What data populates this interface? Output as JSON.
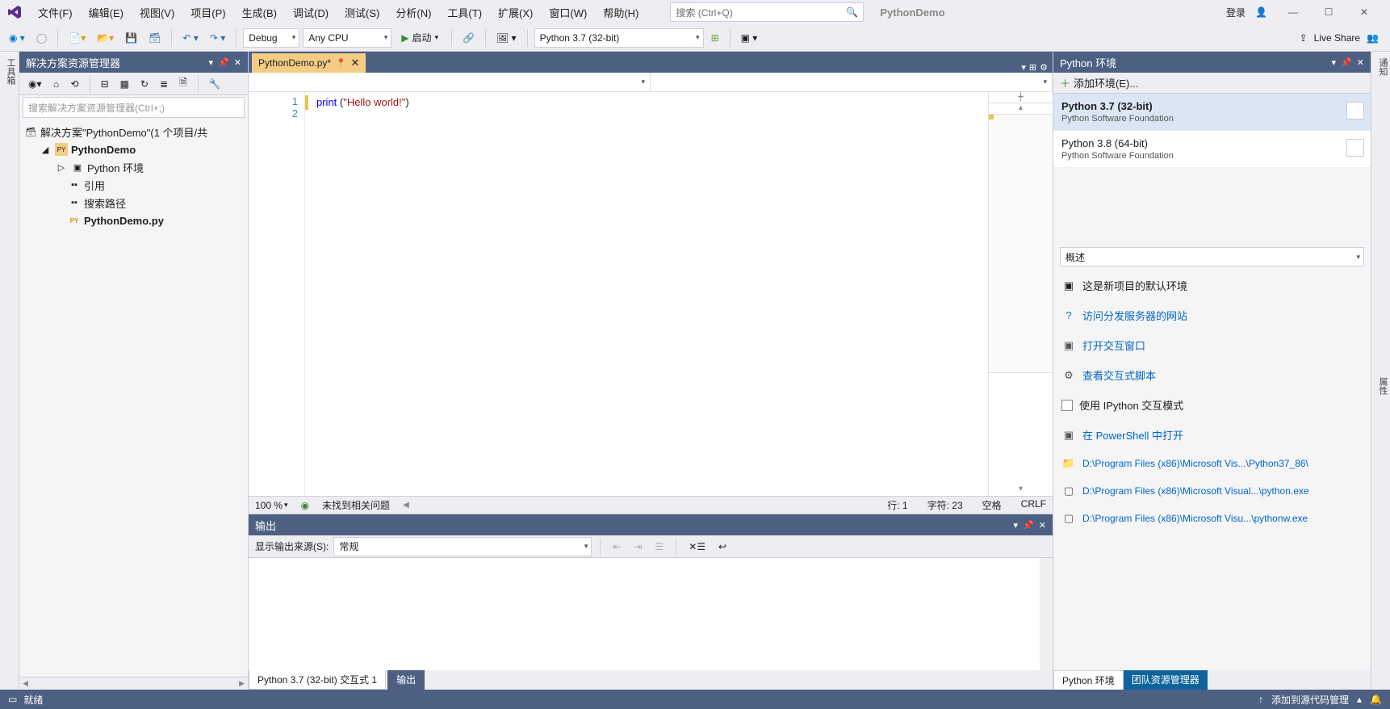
{
  "menus": [
    "文件(F)",
    "编辑(E)",
    "视图(V)",
    "项目(P)",
    "生成(B)",
    "调试(D)",
    "测试(S)",
    "分析(N)",
    "工具(T)",
    "扩展(X)",
    "窗口(W)",
    "帮助(H)"
  ],
  "search_placeholder": "搜索 (Ctrl+Q)",
  "solution_label": "PythonDemo",
  "login": "登录",
  "toolbar": {
    "config": "Debug",
    "platform": "Any CPU",
    "start": "启动",
    "python": "Python 3.7 (32-bit)",
    "liveshare": "Live Share"
  },
  "vert_tab_left": "工具箱",
  "vert_tab_right_1": "通知",
  "vert_tab_right_2": "属性",
  "sln_panel": {
    "title": "解决方案资源管理器",
    "search": "搜索解决方案资源管理器(Ctrl+;)",
    "root": "解决方案\"PythonDemo\"(1 个项目/共",
    "proj": "PythonDemo",
    "env": "Python 环境",
    "ref": "引用",
    "paths": "搜索路径",
    "file": "PythonDemo.py"
  },
  "doc": {
    "tab": "PythonDemo.py*",
    "line1": "1",
    "line2": "2",
    "code_kw": "print",
    "code_paren1": " (",
    "code_str": "\"Hello world!\"",
    "code_paren2": ")"
  },
  "ed_status": {
    "zoom": "100 %",
    "ok": "未找到相关问题",
    "line": "行: 1",
    "col": "字符: 23",
    "ins": "空格",
    "eol": "CRLF"
  },
  "output": {
    "title": "输出",
    "label": "显示输出来源(S):",
    "source": "常规",
    "tab1": "Python 3.7 (32-bit) 交互式 1",
    "tab2": "输出"
  },
  "envs": {
    "title": "Python 环境",
    "add": "添加环境(E)...",
    "list": [
      {
        "name": "Python 3.7 (32-bit)",
        "sub": "Python Software Foundation"
      },
      {
        "name": "Python 3.8 (64-bit)",
        "sub": "Python Software Foundation"
      }
    ],
    "view": "概述",
    "default_env": "这是新项目的默认环境",
    "website": "访问分发服务器的网站",
    "open_interactive": "打开交互窗口",
    "view_scripts": "查看交互式脚本",
    "use_ipython": "使用 IPython 交互模式",
    "open_ps": "在 PowerShell 中打开",
    "path1": "D:\\Program Files (x86)\\Microsoft Vis...\\Python37_86\\",
    "path2": "D:\\Program Files (x86)\\Microsoft Visual...\\python.exe",
    "path3": "D:\\Program Files (x86)\\Microsoft Visu...\\pythonw.exe",
    "tab1": "Python 环境",
    "tab2": "团队资源管理器"
  },
  "status": {
    "ready": "就绪",
    "source_ctrl": "添加到源代码管理"
  }
}
